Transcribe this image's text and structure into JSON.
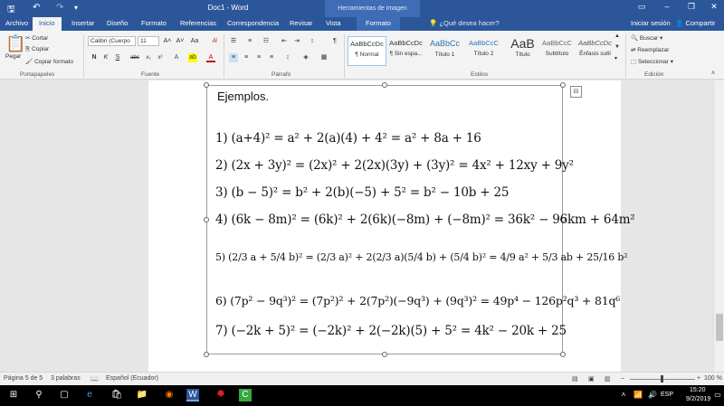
{
  "titlebar": {
    "title": "Doc1 - Word",
    "context_header": "Herramientas de imagen",
    "signin": "Iniciar sesión"
  },
  "tabs": [
    "Archivo",
    "Inicio",
    "Insertar",
    "Diseño",
    "Formato",
    "Referencias",
    "Correspondencia",
    "Revisar",
    "Vista"
  ],
  "context_tab": "Formato",
  "tell_me": "¿Qué desea hacer?",
  "share": "Compartir",
  "ribbon": {
    "clipboard": {
      "paste": "Pegar",
      "cut": "Cortar",
      "copy": "Copiar",
      "format_painter": "Copiar formato",
      "label": "Portapapeles"
    },
    "font": {
      "name": "Calibri (Cuerpo",
      "size": "11",
      "label": "Fuente",
      "bold": "N",
      "italic": "K",
      "underline": "S",
      "strike": "abc",
      "sub": "x₂",
      "sup": "x²"
    },
    "paragraph": {
      "label": "Párrafo",
      "show_marks": "¶"
    },
    "styles": {
      "label": "Estilos",
      "items": [
        {
          "preview": "AaBbCcDc",
          "name": "¶ Normal"
        },
        {
          "preview": "AaBbCcDc",
          "name": "¶ Sin espa..."
        },
        {
          "preview": "AaBbCc",
          "name": "Título 1"
        },
        {
          "preview": "AaBbCcC",
          "name": "Título 2"
        },
        {
          "preview": "AaB",
          "name": "Título"
        },
        {
          "preview": "AaBbCcC",
          "name": "Subtítulo"
        },
        {
          "preview": "AaBbCcDc",
          "name": "Énfasis sutil"
        }
      ]
    },
    "editing": {
      "find": "Buscar",
      "replace": "Reemplazar",
      "select": "Seleccionar",
      "label": "Edición"
    }
  },
  "document": {
    "heading": "Ejemplos.",
    "equations": [
      "1) (a+4)² = a² + 2(a)(4) + 4² = a² + 8a + 16",
      "2) (2x + 3y)² = (2x)² + 2(2x)(3y) + (3y)² = 4x² + 12xy + 9y²",
      "3) (b − 5)² = b² + 2(b)(−5) + 5² = b² − 10b + 25",
      "4) (6k − 8m)² = (6k)² + 2(6k)(−8m) + (−8m)² = 36k² − 96km + 64m²",
      "5) (2/3 a + 5/4 b)² = (2/3 a)² + 2(2/3 a)(5/4 b) + (5/4 b)² = 4/9 a² + 5/3 ab + 25/16 b²",
      "6) (7p² − 9q³)² = (7p²)² + 2(7p²)(−9q³) + (9q³)² = 49p⁴ − 126p²q³ + 81q⁶",
      "7) (−2k + 5)² = (−2k)² + 2(−2k)(5) + 5² = 4k² − 20k + 25"
    ]
  },
  "status": {
    "page": "Página 5 de 5",
    "words": "3 palabras",
    "language": "Español (Ecuador)",
    "zoom": "100 %"
  },
  "taskbar": {
    "time": "15:20",
    "date": "9/2/2019"
  },
  "colors": {
    "word_blue": "#2b579a",
    "ribbon_bg": "#f3f3f3",
    "taskbar_bg": "#000000"
  }
}
